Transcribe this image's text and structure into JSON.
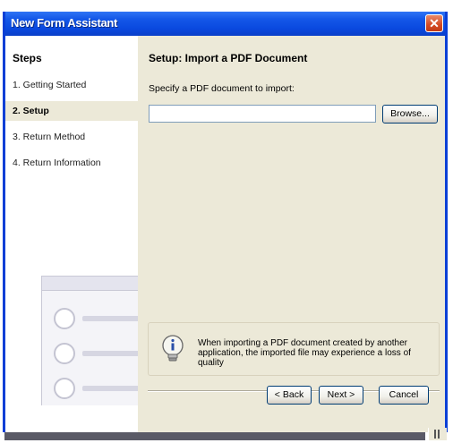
{
  "window": {
    "title": "New Form Assistant",
    "close_glyph": "✕",
    "titlebar_color": "#0a49df",
    "client_color": "#ece9d8"
  },
  "sidebar": {
    "heading": "Steps",
    "steps": [
      {
        "label": "1. Getting Started",
        "active": false
      },
      {
        "label": "2. Setup",
        "active": true
      },
      {
        "label": "3. Return Method",
        "active": false
      },
      {
        "label": "4. Return Information",
        "active": false
      }
    ],
    "art_icon": "list-placeholder-icon"
  },
  "main": {
    "title": "Setup: Import a PDF Document",
    "label": "Specify a PDF document to import:",
    "path_value": "",
    "browse_label": "Browse...",
    "info_icon": "info-bulb-icon",
    "info_text": "When importing a PDF document created by another application, the imported file may experience a loss of quality"
  },
  "footer": {
    "back_label": "< Back",
    "next_label": "Next >",
    "cancel_label": "Cancel"
  }
}
